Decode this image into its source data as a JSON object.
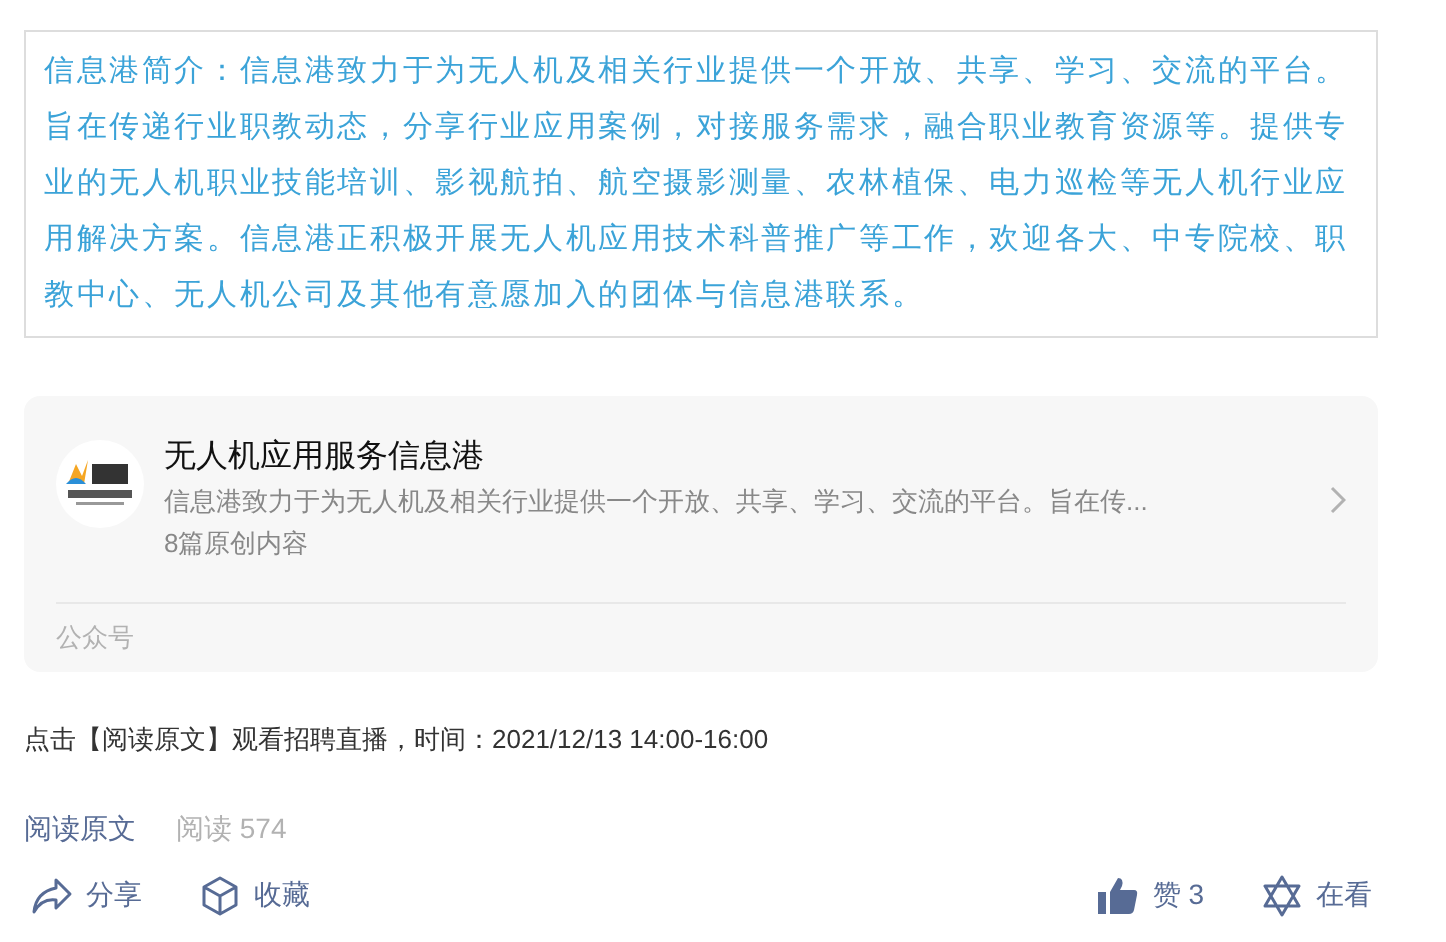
{
  "intro": {
    "text": "信息港简介：信息港致力于为无人机及相关行业提供一个开放、共享、学习、交流的平台。旨在传递行业职教动态，分享行业应用案例，对接服务需求，融合职业教育资源等。提供专业的无人机职业技能培训、影视航拍、航空摄影测量、农林植保、电力巡检等无人机行业应用解决方案。信息港正积极开展无人机应用技术科普推广等工作，欢迎各大、中专院校、职教中心、无人机公司及其他有意愿加入的团体与信息港联系。"
  },
  "account_card": {
    "name": "无人机应用服务信息港",
    "description": "信息港致力于为无人机及相关行业提供一个开放、共享、学习、交流的平台。旨在传...",
    "original_count": "8篇原创内容",
    "type_label": "公众号"
  },
  "notice": "点击【阅读原文】观看招聘直播，时间：2021/12/13 14:00-16:00",
  "read_original": "阅读原文",
  "read_count": {
    "label": "阅读",
    "value": "574"
  },
  "actions": [
    {
      "kind": "share",
      "label": "分享"
    },
    {
      "kind": "collect",
      "label": "收藏"
    },
    {
      "kind": "like",
      "label": "赞 3"
    },
    {
      "kind": "wow",
      "label": "在看"
    }
  ]
}
